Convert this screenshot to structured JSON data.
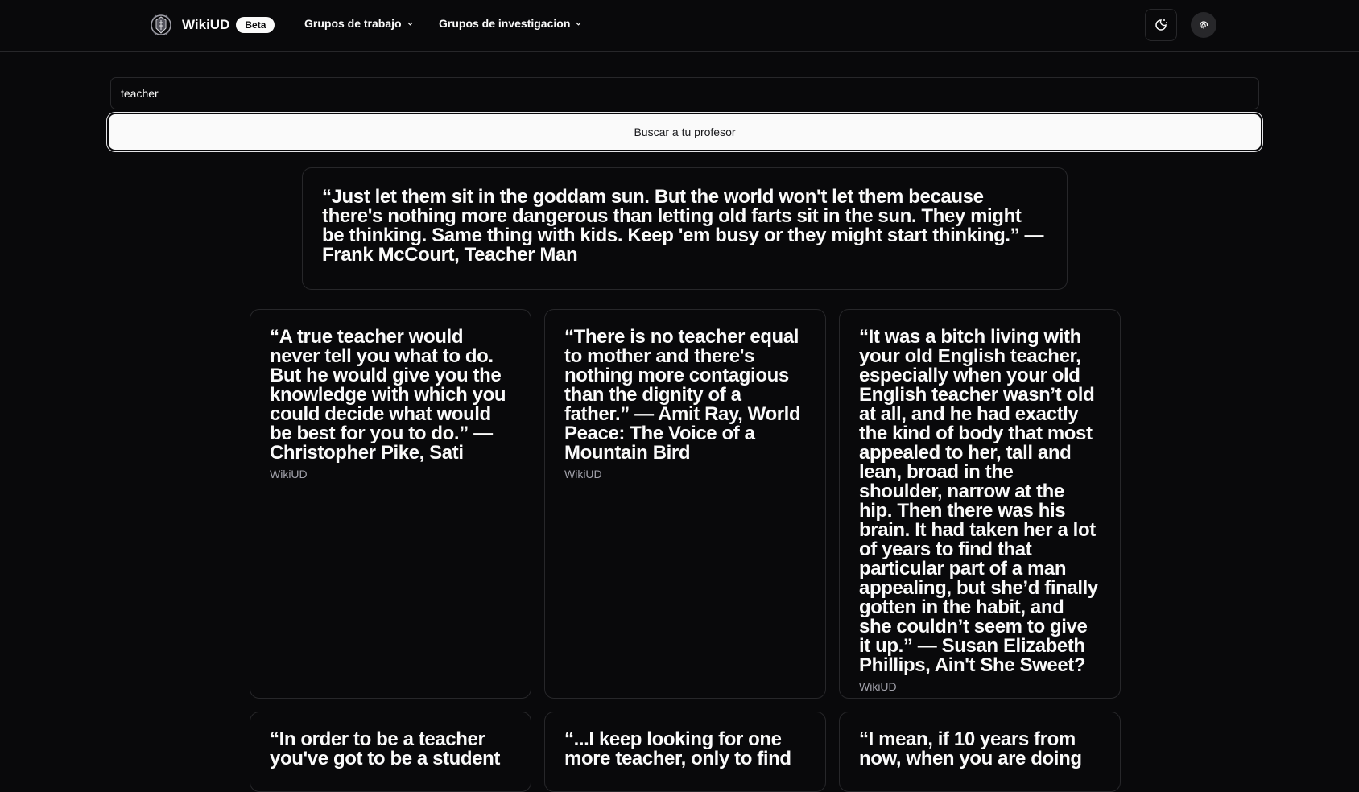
{
  "header": {
    "brand": "WikiUD",
    "badge": "Beta",
    "nav": [
      {
        "label": "Grupos de trabajo"
      },
      {
        "label": "Grupos de investigacion"
      }
    ]
  },
  "search": {
    "value": "teacher",
    "button_label": "Buscar a tu profesor"
  },
  "featured": {
    "text": "“Just let them sit in the goddam sun. But the world won't let them because there's nothing more dangerous than letting old farts sit in the sun. They might be thinking. Same thing with kids. Keep 'em busy or they might start thinking.” ― Frank McCourt, Teacher Man"
  },
  "quotes": [
    {
      "text": "“A true teacher would never tell you what to do. But he would give you the knowledge with which you could decide what would be best for you to do.” ― Christopher Pike, Sati",
      "source": "WikiUD"
    },
    {
      "text": "“There is no teacher equal to mother and there's nothing more contagious than the dignity of a father.” ― Amit Ray, World Peace: The Voice of a Mountain Bird",
      "source": "WikiUD"
    },
    {
      "text": "“It was a bitch living with your old English teacher, especially when your old English teacher wasn’t old at all, and he had exactly the kind of body that most appealed to her, tall and lean, broad in the shoulder, narrow at the hip. Then there was his brain. It had taken her a lot of years to find that particular part of a man appealing, but she’d finally gotten in the habit, and she couldn’t seem to give it up.” ― Susan Elizabeth Phillips, Ain't She Sweet?",
      "source": "WikiUD"
    },
    {
      "text": "“In order to be a teacher you've got to be a student"
    },
    {
      "text": "“...I keep looking for one more teacher, only to find"
    },
    {
      "text": "“I mean, if 10 years from now, when you are doing"
    }
  ],
  "icons": {
    "logo": "university-crest-icon",
    "theme": "moon-sun-icon",
    "profile": "fingerprint-icon",
    "chevron": "chevron-down-icon"
  },
  "colors": {
    "background": "#09090b",
    "border": "#27272a",
    "foreground": "#fafafa",
    "muted": "#a1a1aa"
  }
}
